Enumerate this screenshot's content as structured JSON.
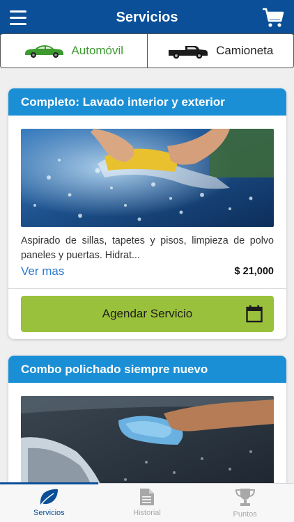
{
  "header": {
    "title": "Servicios",
    "menu_icon": "hamburger-icon",
    "cart_icon": "cart-icon"
  },
  "vehicle_tabs": [
    {
      "label": "Automóvil",
      "icon": "car-icon",
      "active": true
    },
    {
      "label": "Camioneta",
      "icon": "pickup-truck-icon",
      "active": false
    }
  ],
  "services": [
    {
      "title": "Completo: Lavado interior y exterior",
      "description": "Aspirado de sillas, tapetes y pisos, limpieza de polvo paneles y puertas. Hidrat...",
      "more_label": "Ver mas",
      "price": "$ 21,000",
      "button_label": "Agendar Servicio",
      "image": "photo-hands-washing-car-with-sponge"
    },
    {
      "title": "Combo polichado siempre nuevo",
      "image": "photo-hand-polishing-car-with-cloth"
    }
  ],
  "tabbar": [
    {
      "label": "Servicios",
      "icon": "leaf-icon",
      "active": true
    },
    {
      "label": "Historial",
      "icon": "document-icon",
      "active": false
    },
    {
      "label": "Puntos",
      "icon": "trophy-icon",
      "active": false
    }
  ],
  "colors": {
    "primary": "#0a4f98",
    "card_header": "#1b8fd6",
    "button": "#9ac13c",
    "active_green": "#3c9a2f",
    "link": "#2a7ad3"
  }
}
